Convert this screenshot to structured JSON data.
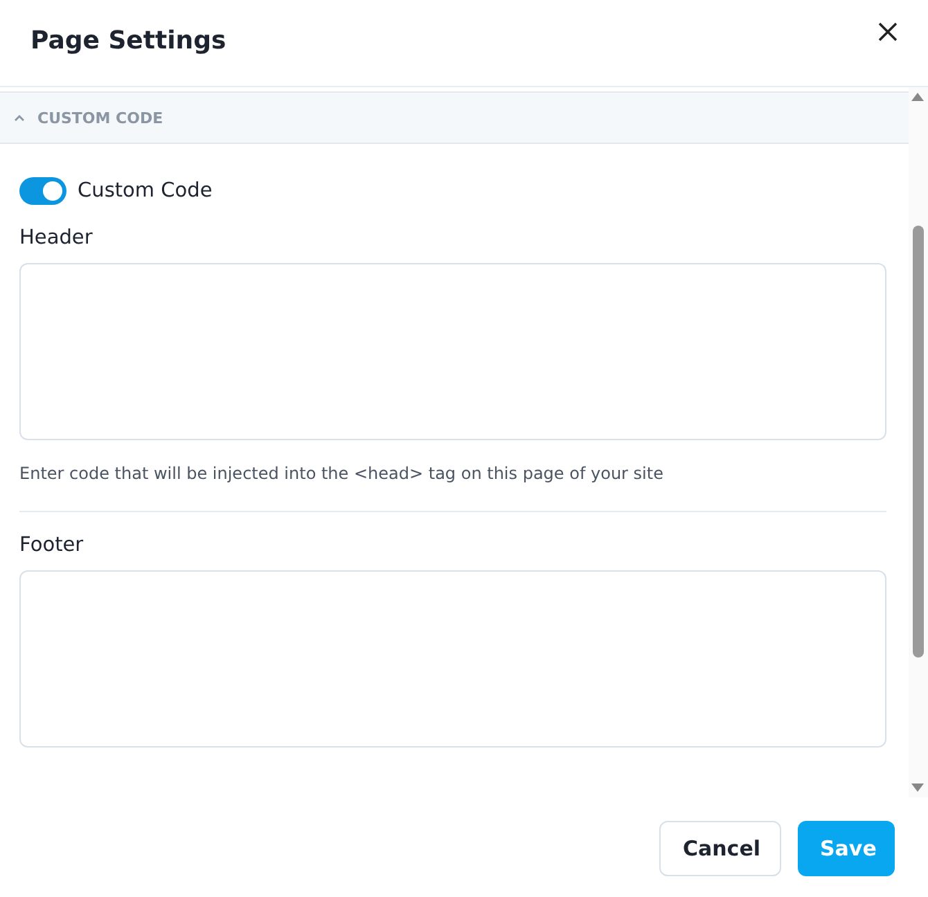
{
  "dialog": {
    "title": "Page Settings"
  },
  "section": {
    "title": "CUSTOM CODE",
    "expanded": true
  },
  "toggle": {
    "label": "Custom Code",
    "on": true
  },
  "fields": [
    {
      "label": "Header",
      "help": "Enter code that will be injected into the <head> tag on this page of your site"
    },
    {
      "label": "Footer"
    }
  ],
  "buttons": [
    {
      "label": "Cancel",
      "kind": "secondary"
    },
    {
      "label": "Save",
      "kind": "primary"
    }
  ]
}
